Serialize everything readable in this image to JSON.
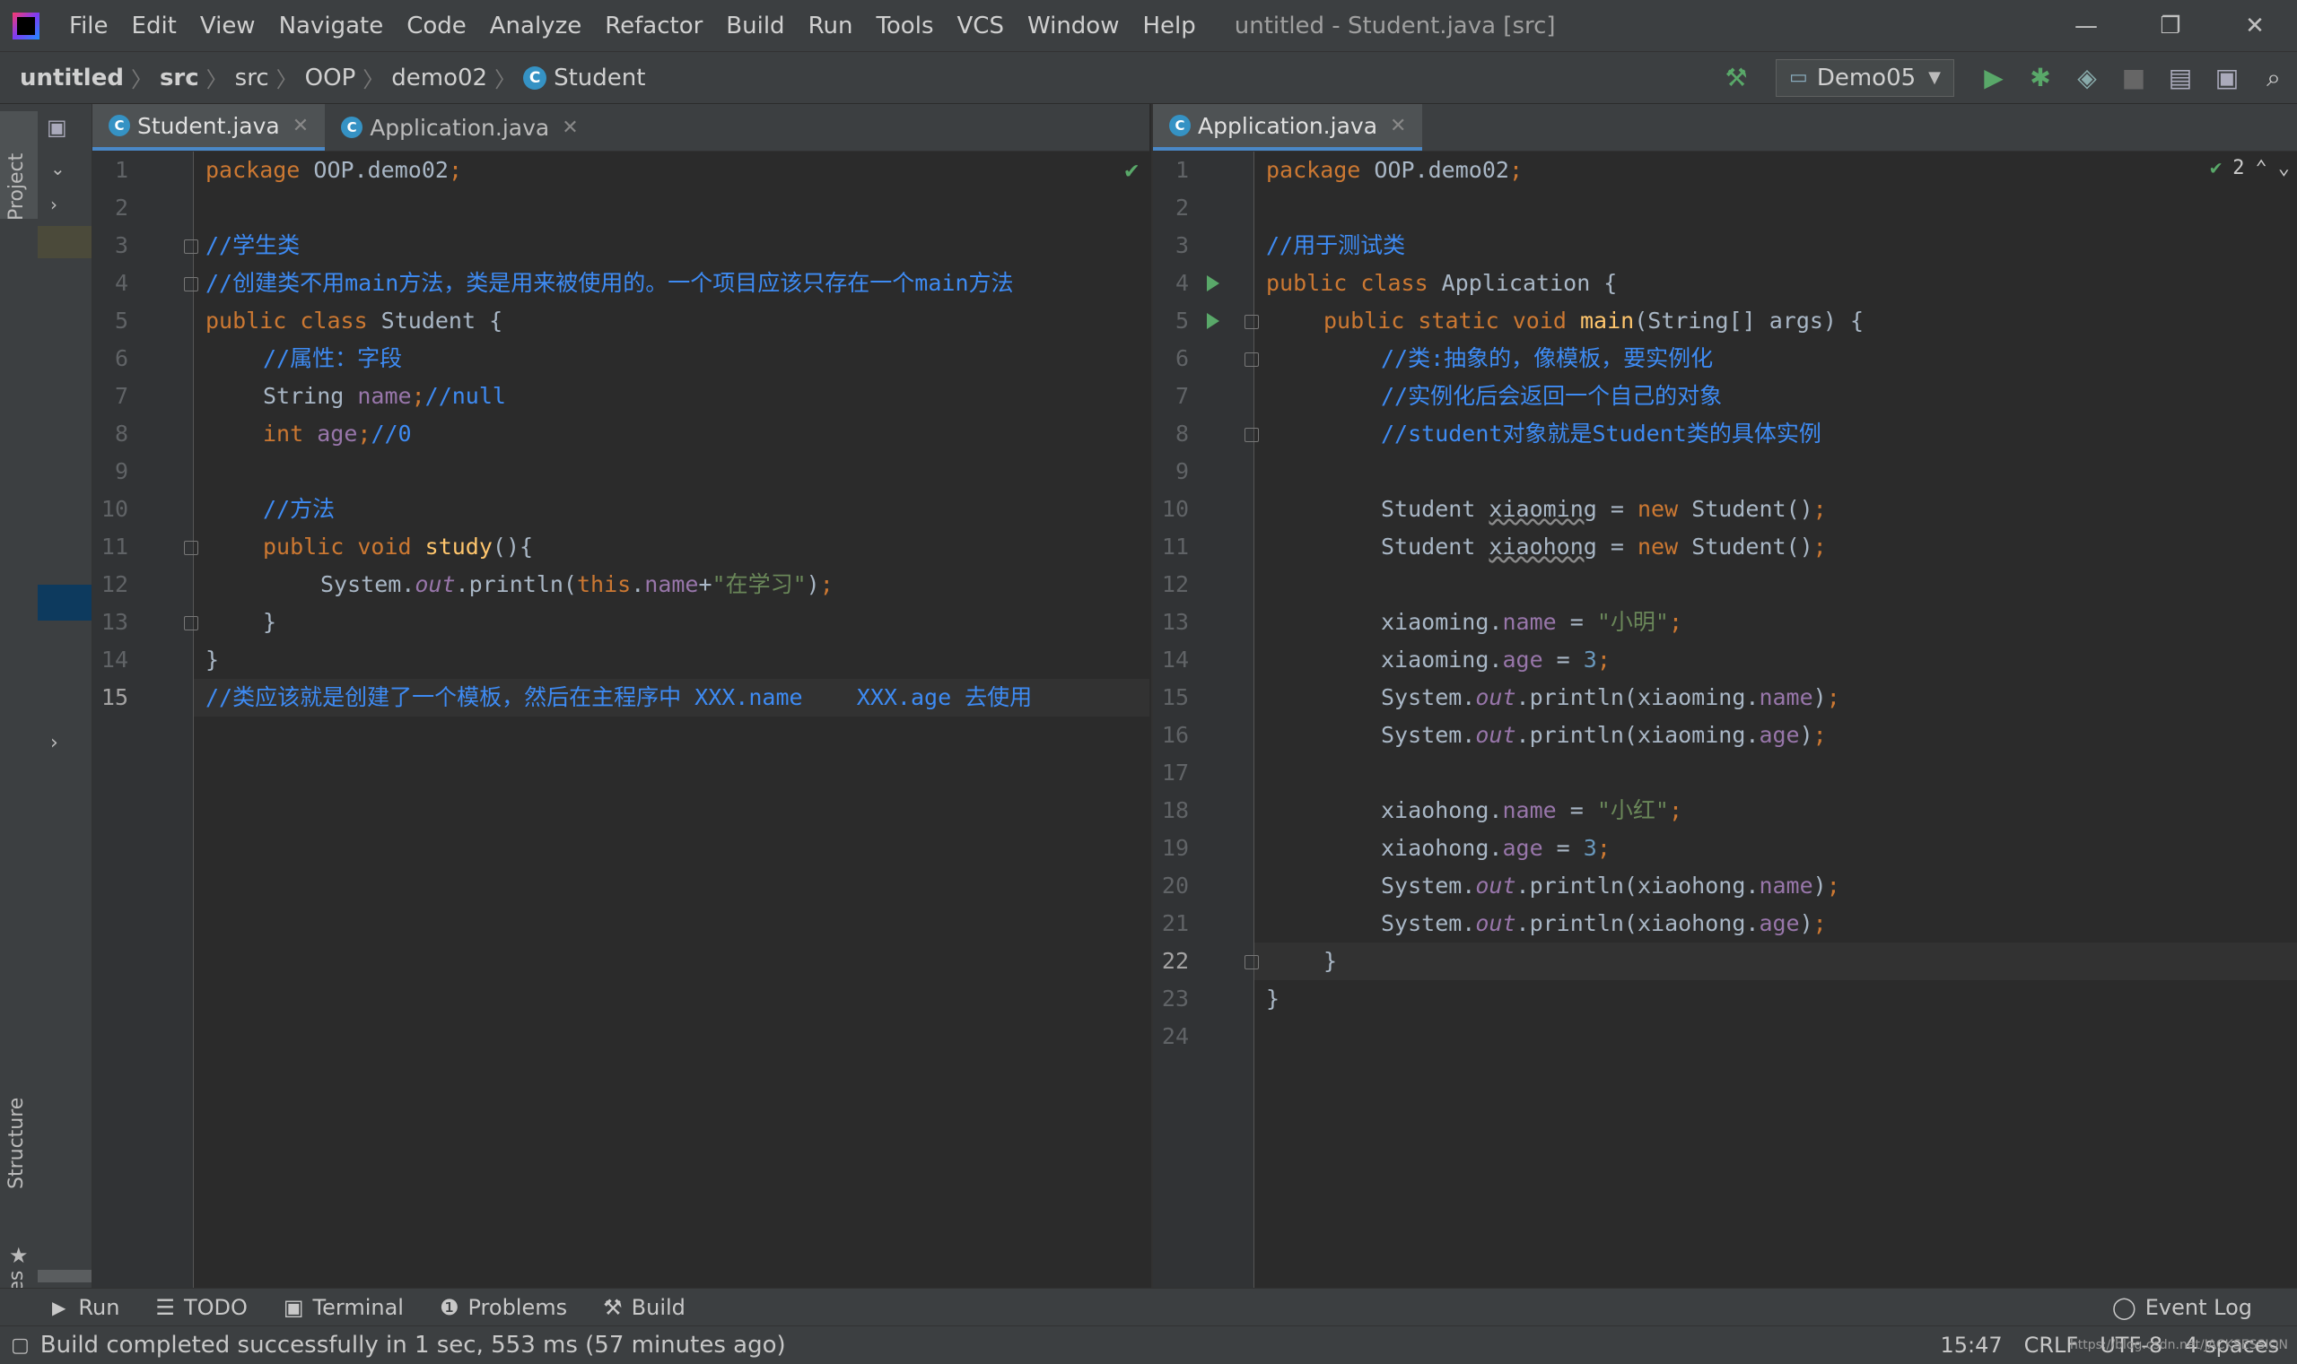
{
  "menubar": {
    "items": [
      "File",
      "Edit",
      "View",
      "Navigate",
      "Code",
      "Analyze",
      "Refactor",
      "Build",
      "Run",
      "Tools",
      "VCS",
      "Window",
      "Help"
    ],
    "window_title": "untitled - Student.java [src]"
  },
  "breadcrumb": [
    "untitled",
    "src",
    "src",
    "OOP",
    "demo02",
    "Student"
  ],
  "toolbar": {
    "run_config": "Demo05"
  },
  "left_strip": {
    "project": "Project",
    "structure": "Structure",
    "favorites": "Favorites"
  },
  "left_editor": {
    "tabs": [
      {
        "label": "Student.java",
        "active": true
      },
      {
        "label": "Application.java",
        "active": false
      }
    ]
  },
  "right_editor": {
    "tabs": [
      {
        "label": "Application.java",
        "active": true
      }
    ],
    "inspection_count": "2"
  },
  "bottom_tools": [
    "Run",
    "TODO",
    "Terminal",
    "Problems",
    "Build"
  ],
  "event_log": "Event Log",
  "status": {
    "message": "Build completed successfully in 1 sec, 553 ms (57 minutes ago)",
    "position": "15:47",
    "line_sep": "CRLF",
    "encoding": "UTF-8",
    "indent": "4 spaces",
    "watermark": "https://blog.csdn.net/JACKSESSION"
  },
  "colors": {
    "keyword": "#cc7832",
    "comment": "#3e8bf3",
    "string": "#6a8759",
    "field": "#9876aa",
    "method": "#ffc66d",
    "number": "#6897bb",
    "accent": "#4a88c7"
  }
}
